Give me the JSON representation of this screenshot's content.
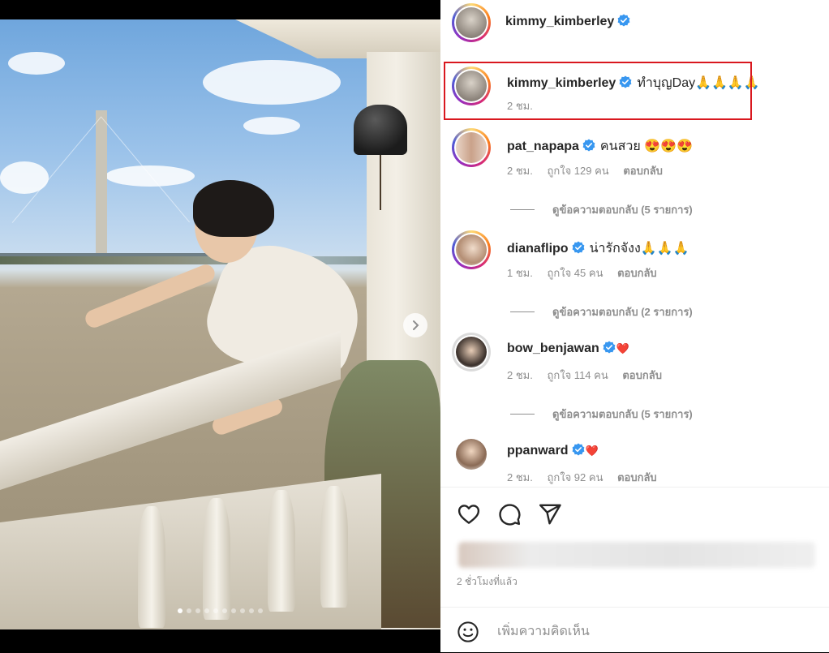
{
  "post": {
    "author": "kimmy_kimberley",
    "carousel": {
      "count": 10,
      "active_index": 0
    }
  },
  "comments": [
    {
      "user": "kimmy_kimberley",
      "verified": true,
      "text": "ทำบุญDay🙏🙏🙏🙏",
      "time": "2 ชม.",
      "likes": "",
      "reply": "",
      "replies_link": "",
      "highlighted": true
    },
    {
      "user": "pat_napapa",
      "verified": true,
      "text": "คนสวย 😍😍😍",
      "time": "2 ชม.",
      "likes": "ถูกใจ 129 คน",
      "reply": "ตอบกลับ",
      "replies_link": "ดูข้อความตอบกลับ (5 รายการ)"
    },
    {
      "user": "dianaflipo",
      "verified": true,
      "text": "น่ารักจังง🙏🙏🙏",
      "time": "1 ชม.",
      "likes": "ถูกใจ 45 คน",
      "reply": "ตอบกลับ",
      "replies_link": "ดูข้อความตอบกลับ (2 รายการ)"
    },
    {
      "user": "bow_benjawan",
      "verified": true,
      "text": "❤️",
      "time": "2 ชม.",
      "likes": "ถูกใจ 114 คน",
      "reply": "ตอบกลับ",
      "replies_link": "ดูข้อความตอบกลับ (5 รายการ)"
    },
    {
      "user": "ppanward",
      "verified": true,
      "text": "❤️",
      "time": "2 ชม.",
      "likes": "ถูกใจ 92 คน",
      "reply": "ตอบกลับ",
      "replies_link": ""
    }
  ],
  "footer": {
    "timestamp": "2 ชั่วโมงที่แล้ว",
    "comment_placeholder": "เพิ่มความคิดเห็น"
  },
  "icons": {
    "like": "heart-outline-icon",
    "comment": "speech-bubble-icon",
    "share": "paper-plane-icon",
    "emoji": "smiley-icon",
    "next": "chevron-right-icon",
    "verified": "verified-badge-icon"
  },
  "colors": {
    "verified_blue": "#3897f0",
    "highlight_red": "#d9181f",
    "muted_text": "#8e8e8e"
  }
}
